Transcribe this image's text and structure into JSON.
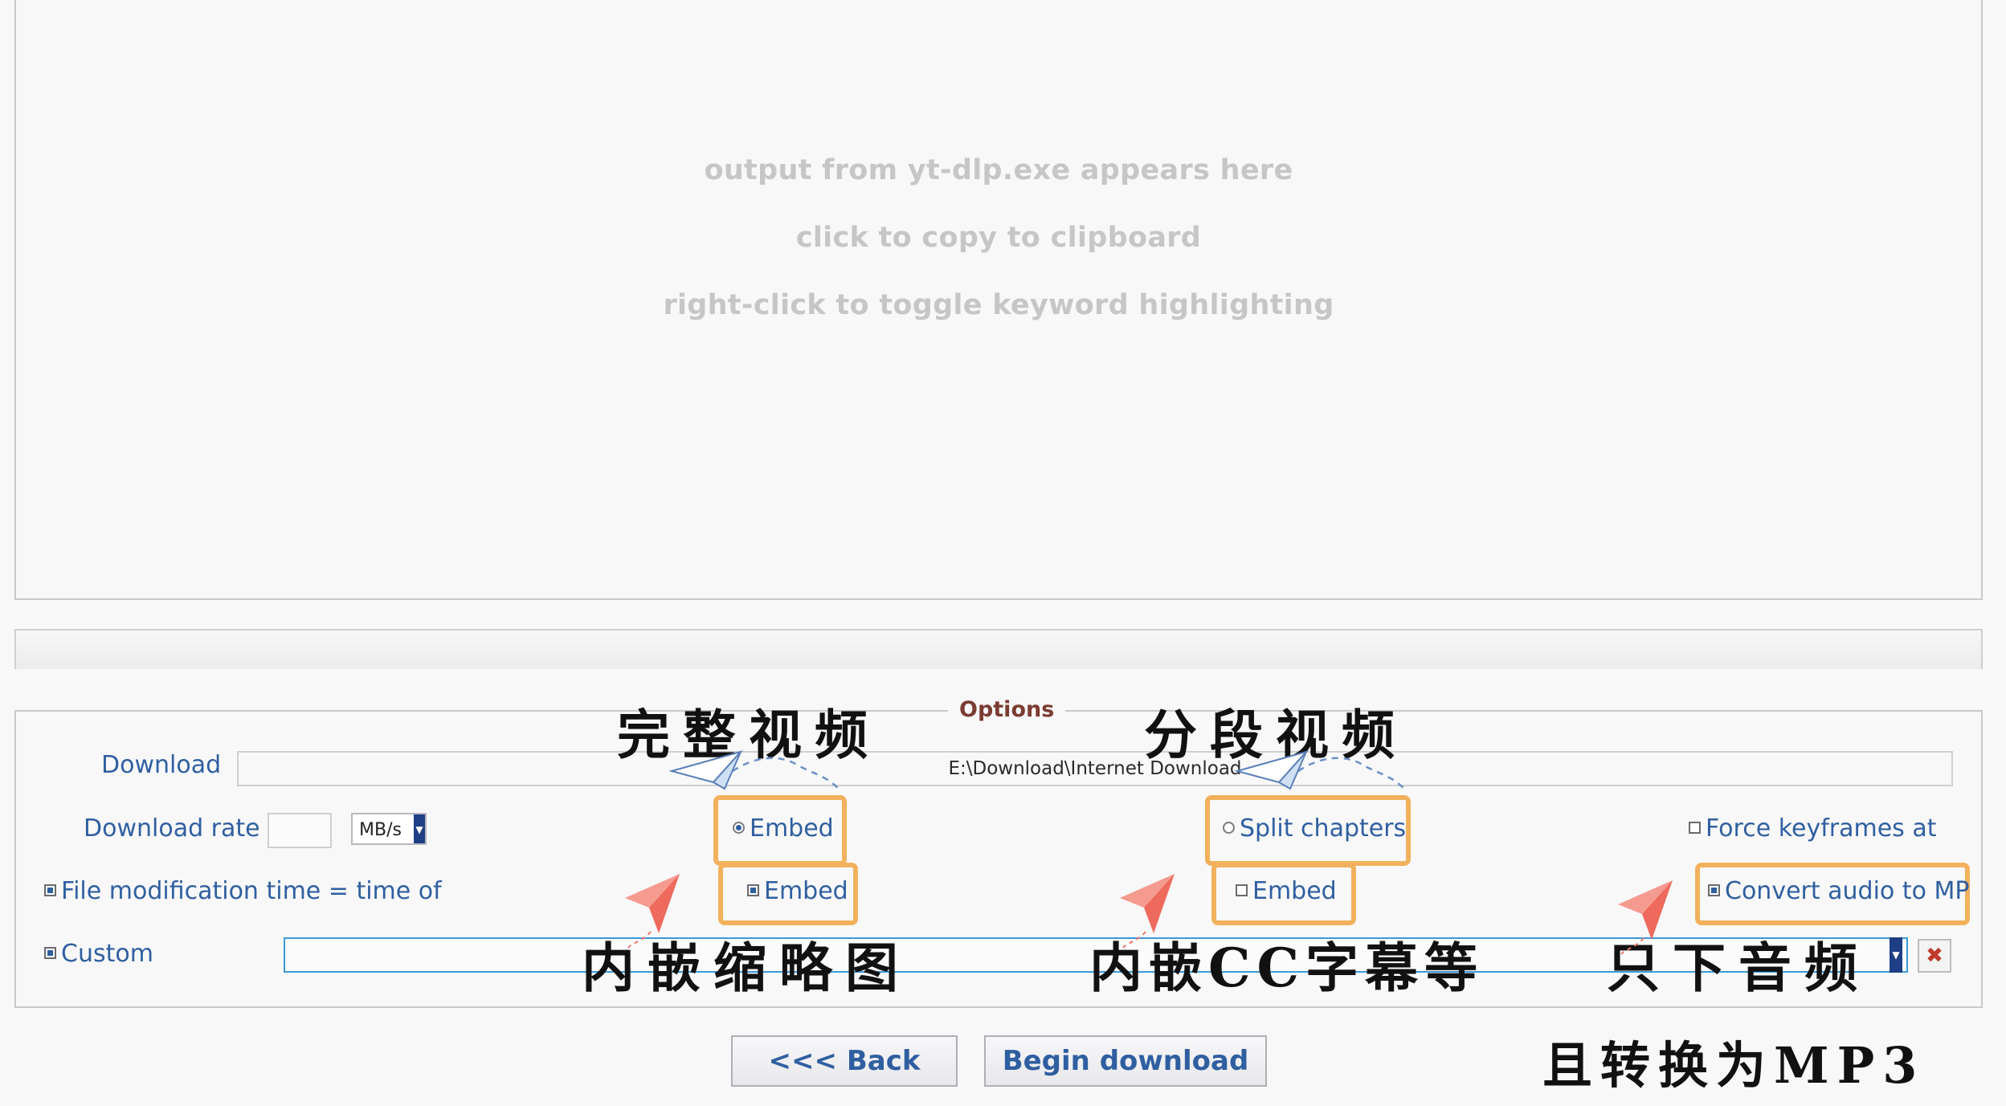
{
  "output": {
    "lines": [
      "output from yt-dlp.exe appears here",
      "click to copy to clipboard",
      "right-click to toggle keyword highlighting"
    ]
  },
  "options": {
    "title": "Options",
    "download_label": "Download",
    "download_path": "E:\\Download\\Internet Download",
    "rate_label": "Download rate",
    "rate_value": "",
    "rate_unit": "MB/s",
    "embed_video_label": "Embed",
    "split_chapters_label": "Split chapters",
    "force_keyframes_label": "Force keyframes at",
    "file_mod_label": "File modification time = time of",
    "embed_thumb_label": "Embed",
    "embed_subs_label": "Embed",
    "convert_audio_label": "Convert audio to MP",
    "custom_label": "Custom",
    "custom_value": "",
    "clear_icon": "close-icon"
  },
  "buttons": {
    "back": "<<< Back",
    "begin": "Begin download"
  },
  "annotations": {
    "full_video": "完整视频",
    "split_video": "分段视频",
    "embed_thumbnail": "内嵌缩略图",
    "embed_cc": "内嵌CC字幕等",
    "audio_only": "只下音频",
    "convert_mp3": "且转换为MP3"
  },
  "colors": {
    "highlight": "#f2b15c",
    "label_blue": "#2f5fa0",
    "plane_red": "#f07466"
  }
}
